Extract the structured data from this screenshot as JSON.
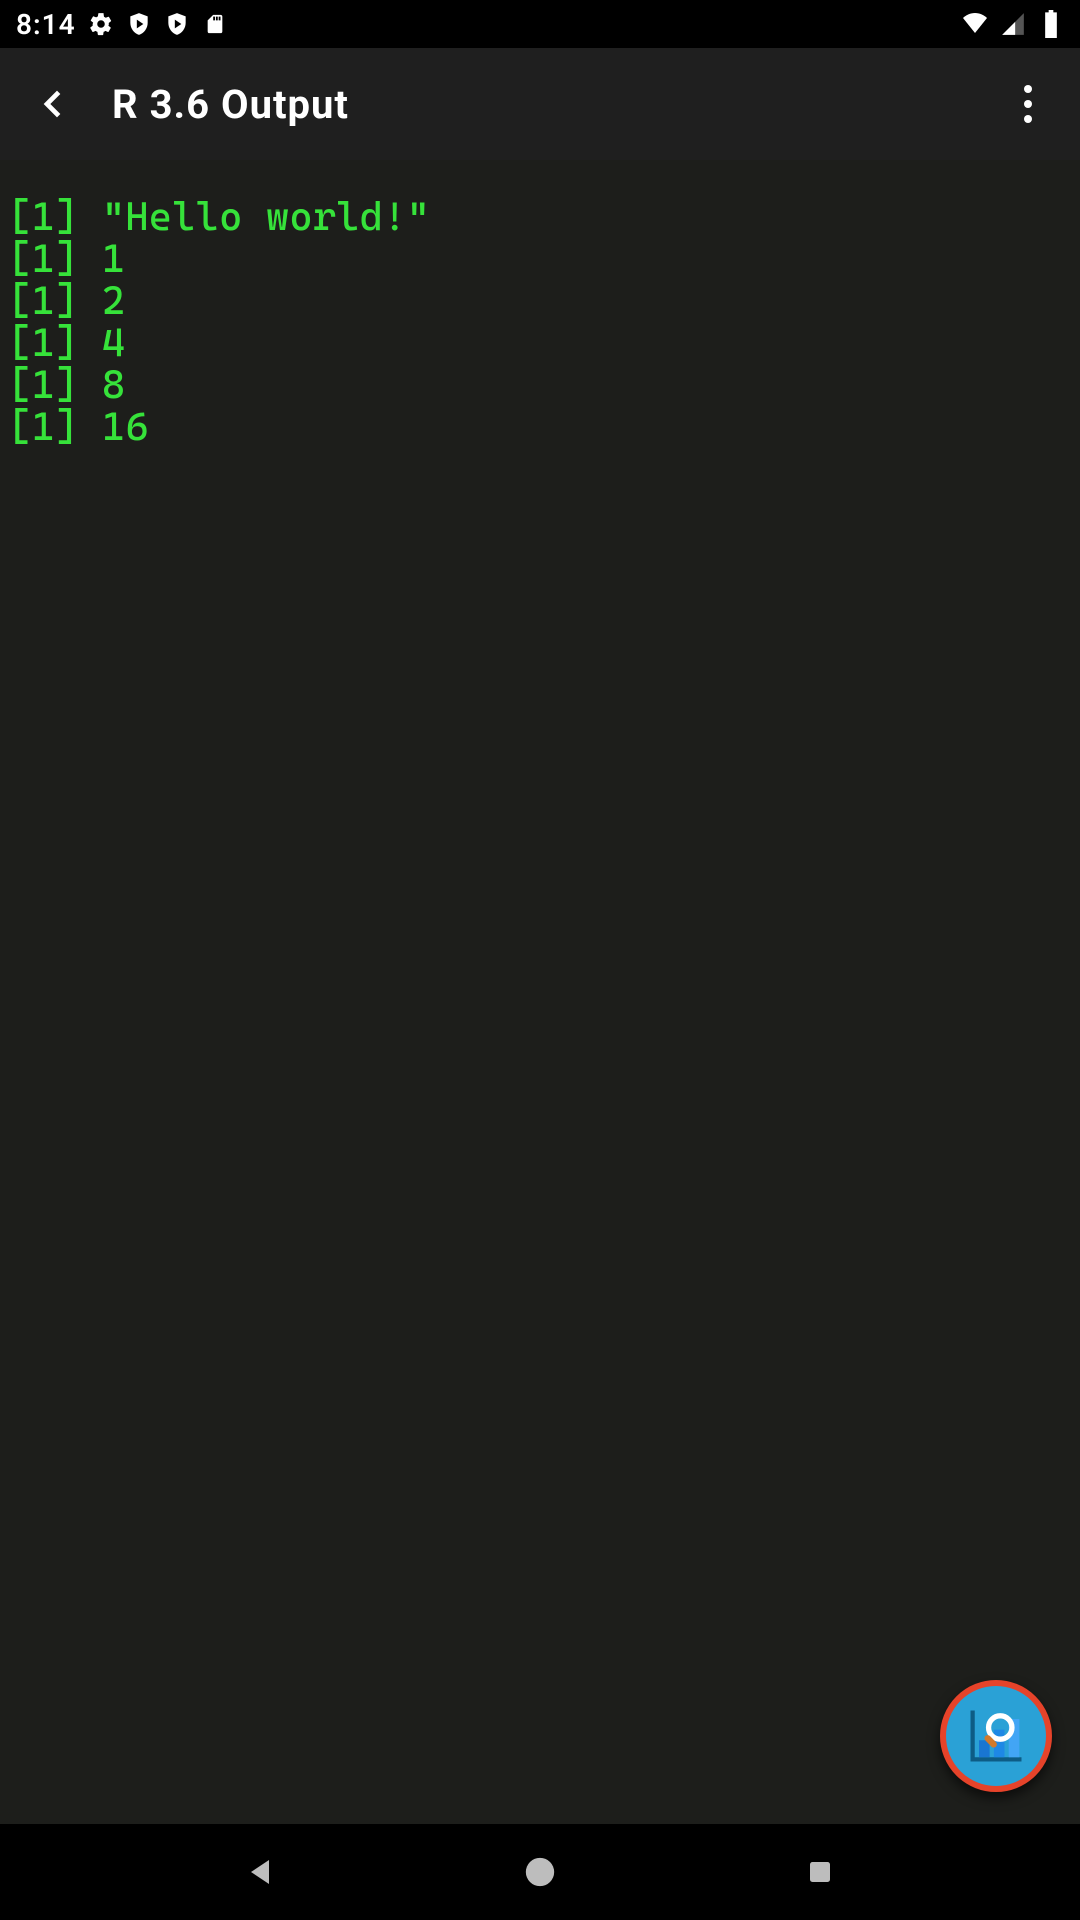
{
  "status": {
    "time": "8:14",
    "left_icons": [
      "gear",
      "shield-play",
      "shield-play",
      "sd-card"
    ],
    "right_icons": [
      "wifi",
      "signal",
      "battery"
    ]
  },
  "appbar": {
    "title": "R 3.6 Output"
  },
  "output": {
    "lines": [
      "[1] \"Hello world!\"",
      "[1] 1",
      "[1] 2",
      "[1] 4",
      "[1] 8",
      "[1] 16"
    ]
  },
  "colors": {
    "output_fg": "#36e23a",
    "output_bg": "#1d1e1b",
    "appbar_bg": "#1f1f1f",
    "fab_bg": "#2aa1d6",
    "fab_border": "#e6432a"
  }
}
